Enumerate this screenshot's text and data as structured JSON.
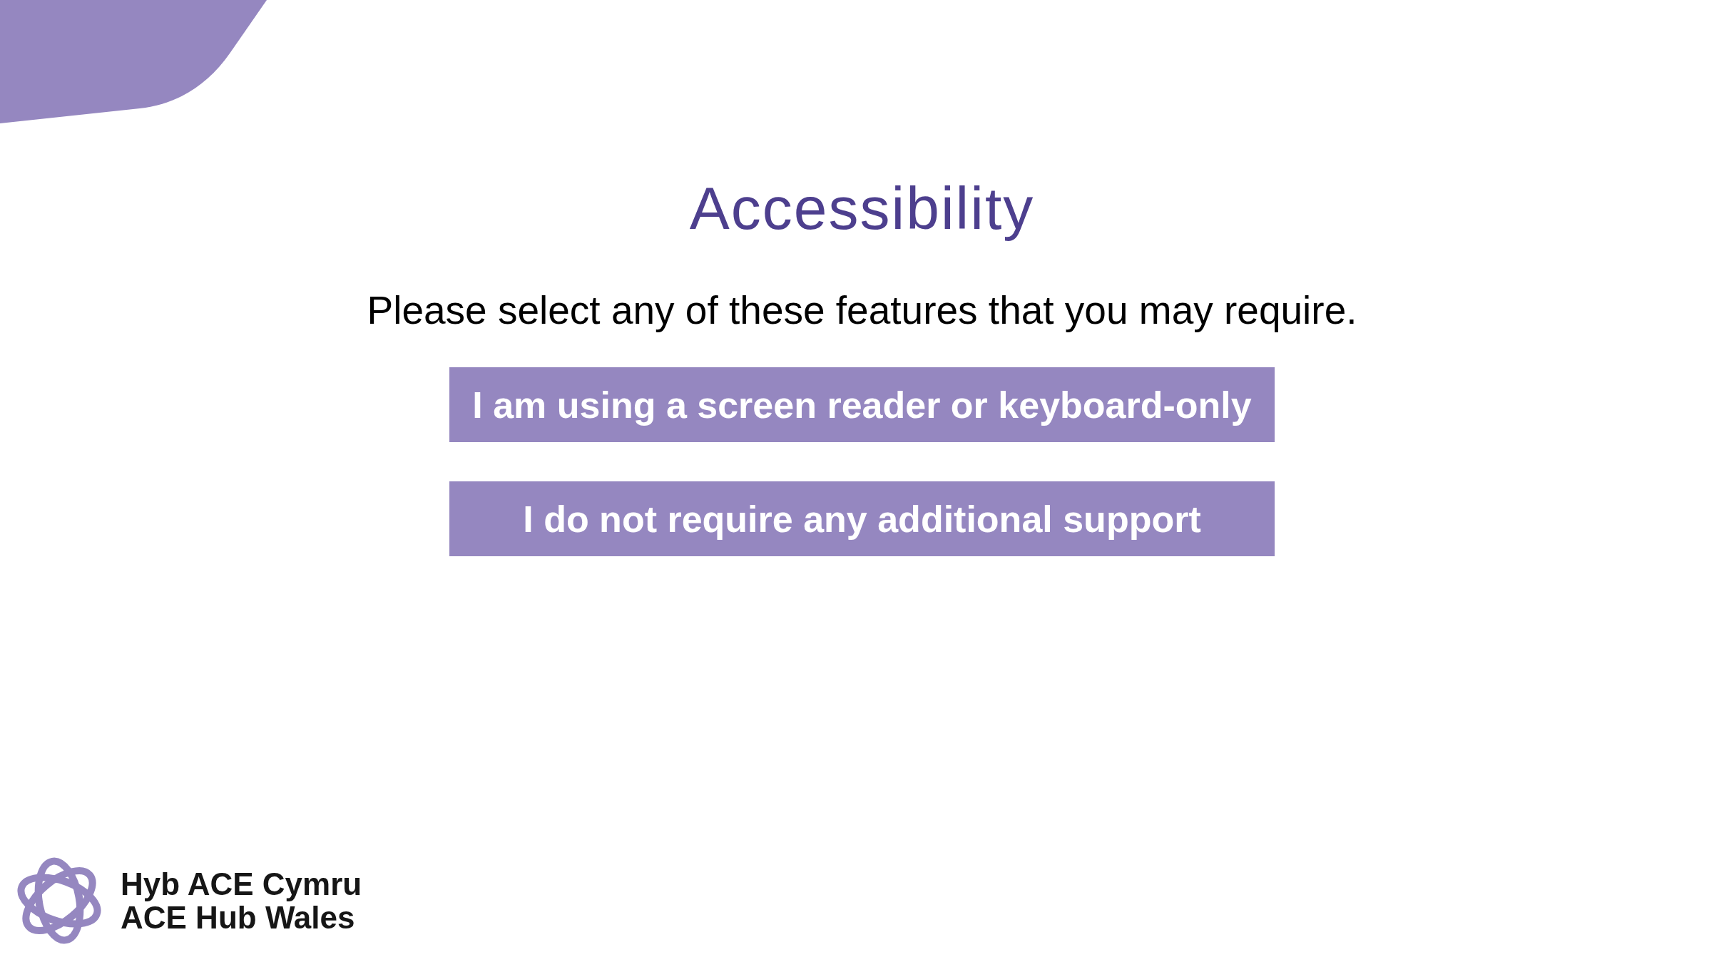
{
  "title": "Accessibility",
  "prompt": "Please select any of these features that you may require.",
  "options": [
    {
      "label": "I am using a screen reader or keyboard-only"
    },
    {
      "label": "I do not require any additional support"
    }
  ],
  "logo": {
    "lines": [
      "Hyb ACE Cymru",
      "ACE Hub Wales"
    ]
  }
}
